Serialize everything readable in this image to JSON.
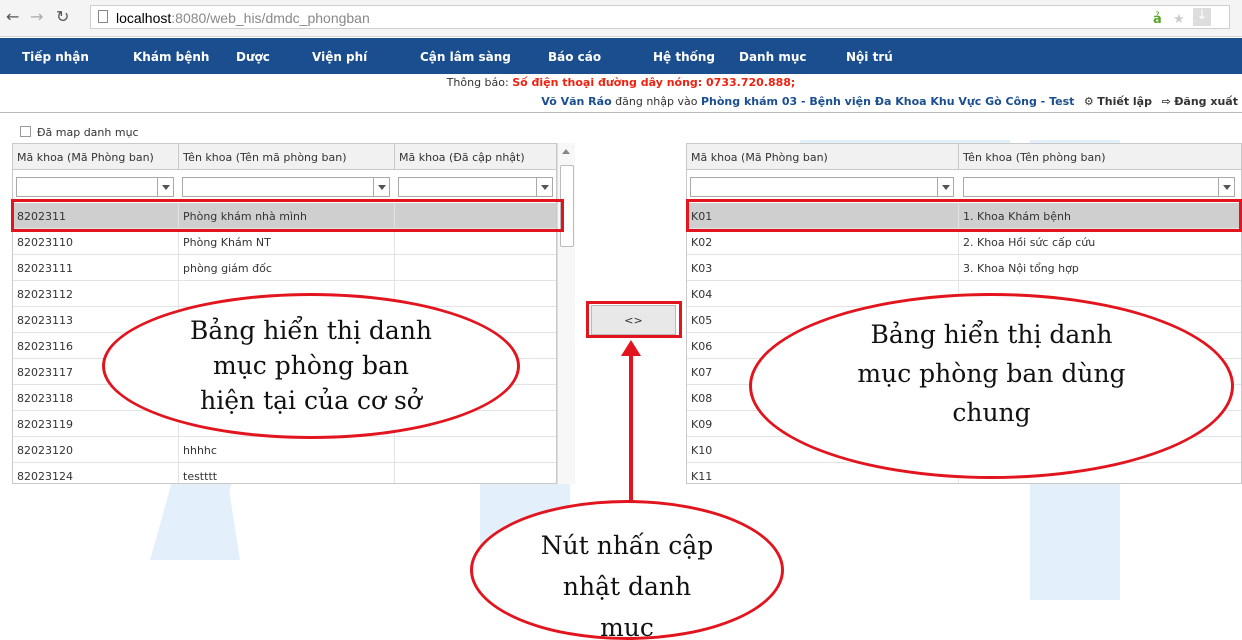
{
  "browser": {
    "url_host": "localhost",
    "url_path": ":8080/web_his/dmdc_phongban"
  },
  "menu": [
    "Tiếp nhận",
    "Khám bệnh",
    "Dược",
    "Viện phí",
    "Cận lâm sàng",
    "Báo cáo",
    "Hệ thống",
    "Danh mục",
    "Nội trú"
  ],
  "notice": {
    "label": "Thông báo:",
    "text": "Số điện thoại đường dây nóng: 0733.720.888;"
  },
  "login": {
    "user": "Võ Văn Ráo",
    "middle": "đăng nhập vào",
    "place": "Phòng khám 03 -  Bệnh viện Đa Khoa Khu Vực Gò Công - Test",
    "settings": "Thiết lập",
    "logout": "Đăng xuất"
  },
  "checkbox_label": "Đã map danh mục",
  "left_grid": {
    "headers": [
      "Mã khoa (Mã Phòng ban)",
      "Tên khoa (Tên mã phòng ban)",
      "Mã khoa (Đã cập nhật)"
    ],
    "rows": [
      [
        "8202311",
        "Phòng khám nhà mình",
        ""
      ],
      [
        "82023110",
        "Phòng Khám NT",
        ""
      ],
      [
        "82023111",
        "phòng giám đốc",
        ""
      ],
      [
        "82023112",
        "",
        ""
      ],
      [
        "82023113",
        "",
        ""
      ],
      [
        "82023116",
        "",
        ""
      ],
      [
        "82023117",
        "",
        ""
      ],
      [
        "82023118",
        "",
        ""
      ],
      [
        "82023119",
        "",
        ""
      ],
      [
        "82023120",
        "hhhhc",
        ""
      ],
      [
        "82023124",
        "testttt",
        ""
      ]
    ]
  },
  "right_grid": {
    "headers": [
      "Mã khoa (Mã Phòng ban)",
      "Tên khoa (Tên phòng ban)"
    ],
    "rows": [
      [
        "K01",
        "1. Khoa Khám bệnh"
      ],
      [
        "K02",
        "2. Khoa Hồi sức cấp cứu"
      ],
      [
        "K03",
        "3. Khoa Nội tổng hợp"
      ],
      [
        "K04",
        ""
      ],
      [
        "K05",
        ""
      ],
      [
        "K06",
        ""
      ],
      [
        "K07",
        ""
      ],
      [
        "K08",
        ""
      ],
      [
        "K09",
        ""
      ],
      [
        "K10",
        ""
      ],
      [
        "K11",
        ""
      ]
    ]
  },
  "map_button": "<>",
  "annotations": {
    "left": [
      "Bảng hiển thị danh",
      "mục phòng ban",
      "hiện tại của cơ sở"
    ],
    "right": [
      "Bảng hiển thị danh",
      "mục phòng ban dùng",
      "chung"
    ],
    "bottom": [
      "Nút nhấn cập",
      "nhật danh",
      "mục"
    ]
  },
  "colors": {
    "menu_bg": "#1a4e8e",
    "annotation_red": "#e2141e",
    "watermark": "#e3f0fb"
  }
}
